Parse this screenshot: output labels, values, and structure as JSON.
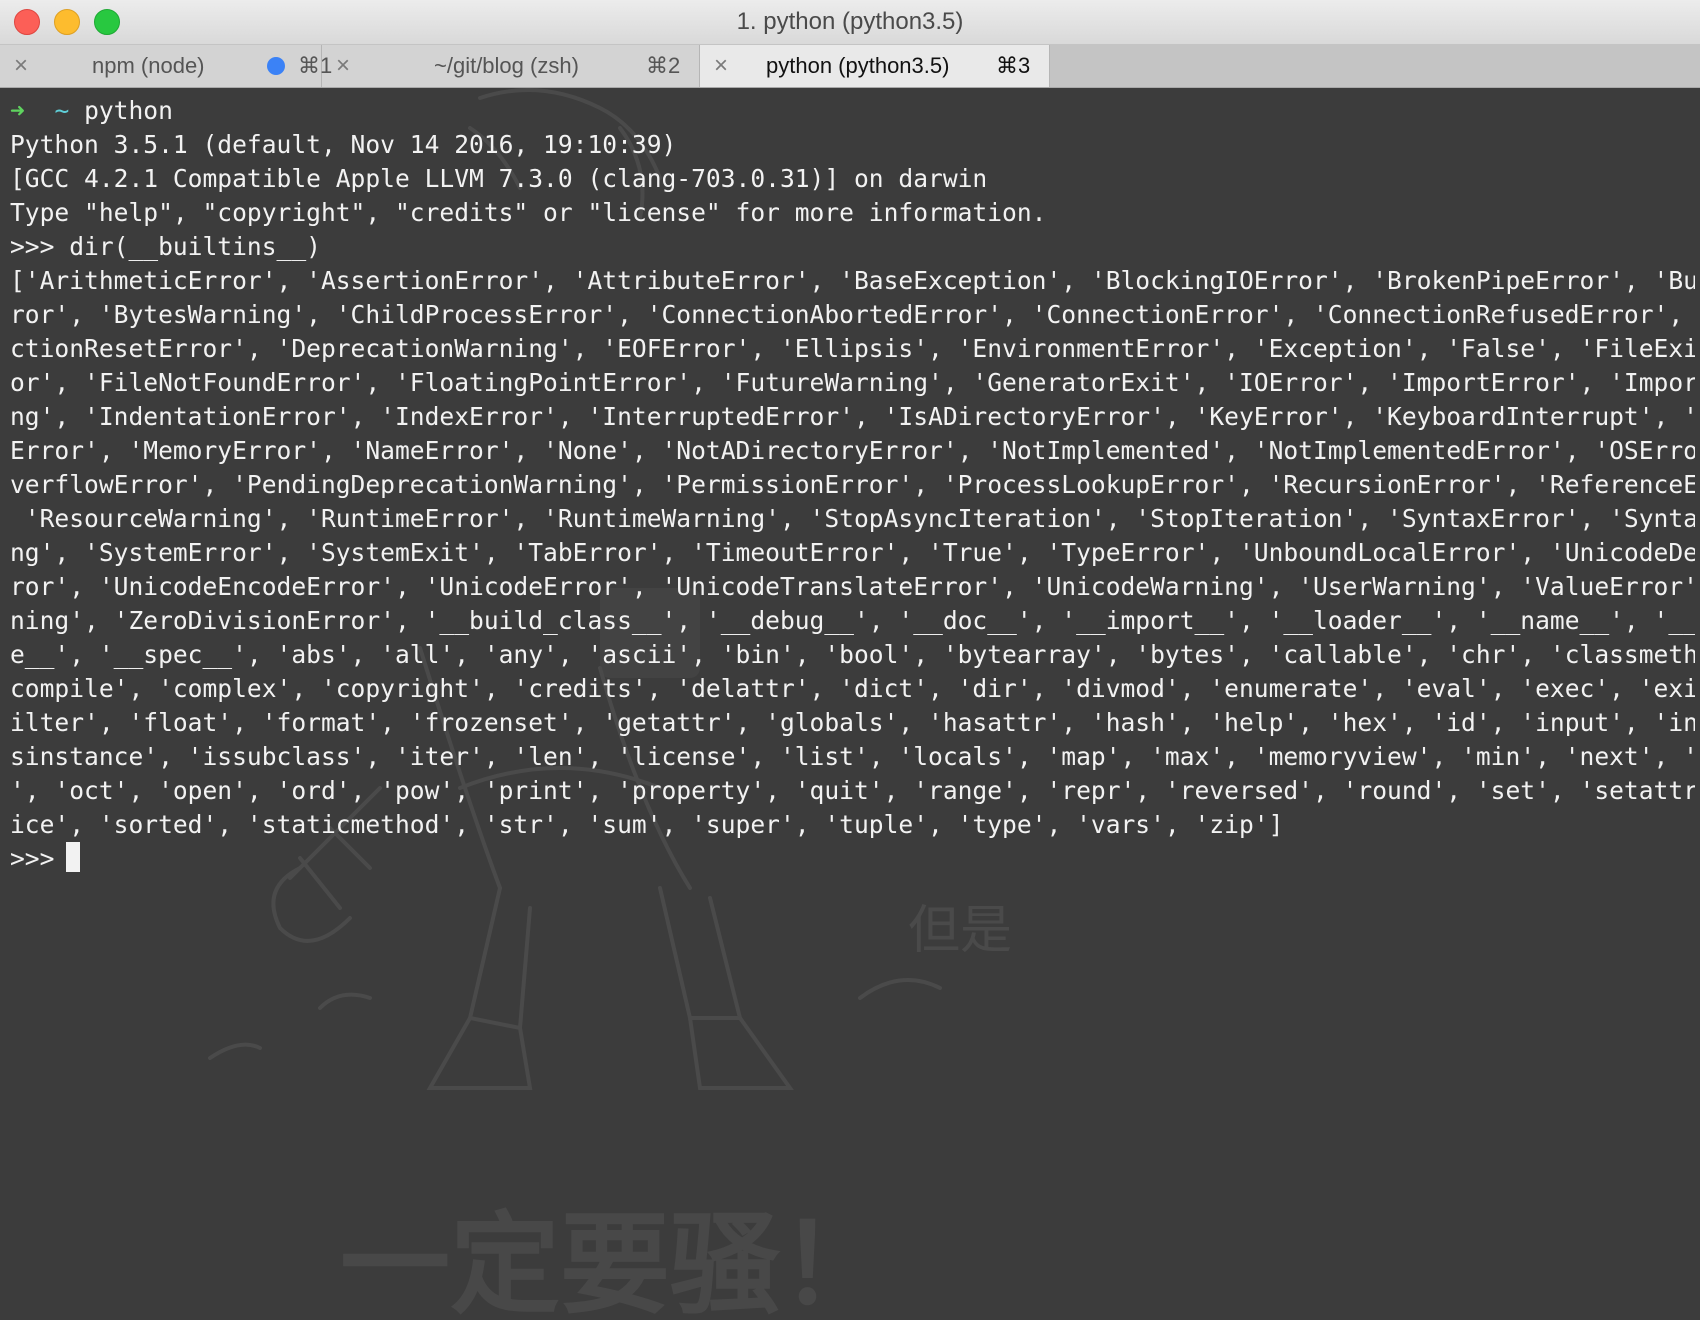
{
  "window": {
    "title": "1. python (python3.5)"
  },
  "tabs": [
    {
      "close": "×",
      "label": "npm (node)",
      "shortcut": "⌘1",
      "has_dot": true,
      "active": false
    },
    {
      "close": "×",
      "label": "~/git/blog (zsh)",
      "shortcut": "⌘2",
      "has_dot": false,
      "active": false
    },
    {
      "close": "×",
      "label": "python (python3.5)",
      "shortcut": "⌘3",
      "has_dot": false,
      "active": true
    }
  ],
  "terminal": {
    "prompt_arrow": "➜",
    "prompt_dir": "~",
    "prompt_cmd": "python",
    "lines": [
      "Python 3.5.1 (default, Nov 14 2016, 19:10:39)",
      "[GCC 4.2.1 Compatible Apple LLVM 7.3.0 (clang-703.0.31)] on darwin",
      "Type \"help\", \"copyright\", \"credits\" or \"license\" for more information.",
      ">>> dir(__builtins__)",
      "['ArithmeticError', 'AssertionError', 'AttributeError', 'BaseException', 'BlockingIOError', 'BrokenPipeError', 'BufferEr",
      "ror', 'BytesWarning', 'ChildProcessError', 'ConnectionAbortedError', 'ConnectionError', 'ConnectionRefusedError', 'Conne",
      "ctionResetError', 'DeprecationWarning', 'EOFError', 'Ellipsis', 'EnvironmentError', 'Exception', 'False', 'FileExistsErr",
      "or', 'FileNotFoundError', 'FloatingPointError', 'FutureWarning', 'GeneratorExit', 'IOError', 'ImportError', 'ImportWarni",
      "ng', 'IndentationError', 'IndexError', 'InterruptedError', 'IsADirectoryError', 'KeyError', 'KeyboardInterrupt', 'Lookup",
      "Error', 'MemoryError', 'NameError', 'None', 'NotADirectoryError', 'NotImplemented', 'NotImplementedError', 'OSError', 'O",
      "verflowError', 'PendingDeprecationWarning', 'PermissionError', 'ProcessLookupError', 'RecursionError', 'ReferenceError',",
      " 'ResourceWarning', 'RuntimeError', 'RuntimeWarning', 'StopAsyncIteration', 'StopIteration', 'SyntaxError', 'SyntaxWarni",
      "ng', 'SystemError', 'SystemExit', 'TabError', 'TimeoutError', 'True', 'TypeError', 'UnboundLocalError', 'UnicodeDecodeEr",
      "ror', 'UnicodeEncodeError', 'UnicodeError', 'UnicodeTranslateError', 'UnicodeWarning', 'UserWarning', 'ValueError', 'War",
      "ning', 'ZeroDivisionError', '__build_class__', '__debug__', '__doc__', '__import__', '__loader__', '__name__', '__packag",
      "e__', '__spec__', 'abs', 'all', 'any', 'ascii', 'bin', 'bool', 'bytearray', 'bytes', 'callable', 'chr', 'classmethod', '",
      "compile', 'complex', 'copyright', 'credits', 'delattr', 'dict', 'dir', 'divmod', 'enumerate', 'eval', 'exec', 'exit', 'f",
      "ilter', 'float', 'format', 'frozenset', 'getattr', 'globals', 'hasattr', 'hash', 'help', 'hex', 'id', 'input', 'int', 'i",
      "sinstance', 'issubclass', 'iter', 'len', 'license', 'list', 'locals', 'map', 'max', 'memoryview', 'min', 'next', 'object",
      "', 'oct', 'open', 'ord', 'pow', 'print', 'property', 'quit', 'range', 'repr', 'reversed', 'round', 'set', 'setattr', 'sl",
      "ice', 'sorted', 'staticmethod', 'str', 'sum', 'super', 'tuple', 'type', 'vars', 'zip']"
    ],
    "final_prompt": ">>>",
    "background_text": [
      "一定要骚！",
      "但是"
    ]
  }
}
